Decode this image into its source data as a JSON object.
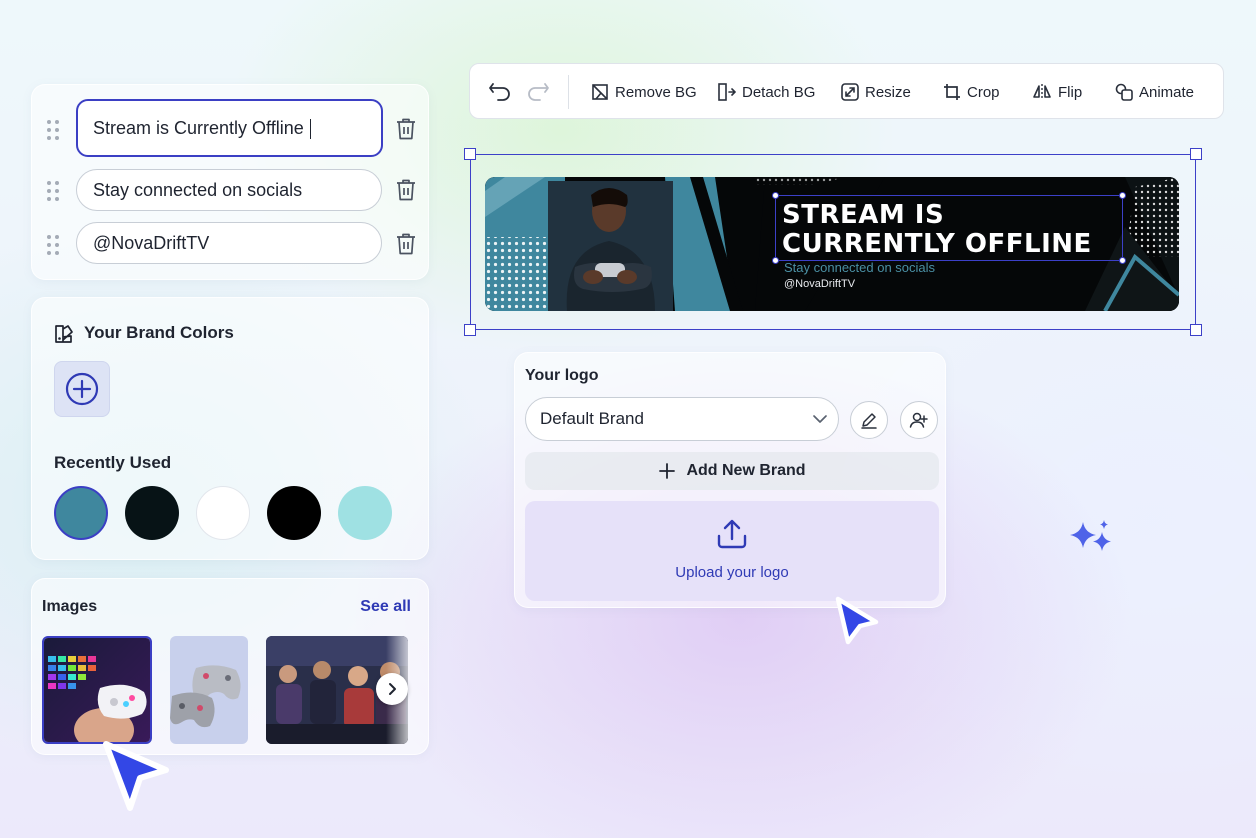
{
  "text_rows": [
    {
      "value": "Stream is Currently Offline"
    },
    {
      "value": "Stay connected on socials"
    },
    {
      "value": "@NovaDriftTV"
    }
  ],
  "brand_colors": {
    "title": "Your Brand Colors",
    "recent_title": "Recently Used",
    "recent": [
      "#3f879e",
      "#071316",
      "#ffffff",
      "#000000",
      "#9fe1e3"
    ]
  },
  "images": {
    "title": "Images",
    "see_all": "See all"
  },
  "toolbar": {
    "remove_bg": "Remove BG",
    "detach_bg": "Detach BG",
    "resize": "Resize",
    "crop": "Crop",
    "flip": "Flip",
    "animate": "Animate"
  },
  "banner": {
    "title_line1": "STREAM IS",
    "title_line2": "CURRENTLY OFFLINE",
    "subtitle": "Stay connected on socials",
    "handle": "@NovaDriftTV"
  },
  "logo": {
    "title": "Your logo",
    "selected_brand": "Default Brand",
    "add_brand": "Add New Brand",
    "upload": "Upload your logo"
  },
  "colors": {
    "accent": "#3b3fc4",
    "link": "#2f3ab5",
    "cursor": "#3347e6"
  }
}
